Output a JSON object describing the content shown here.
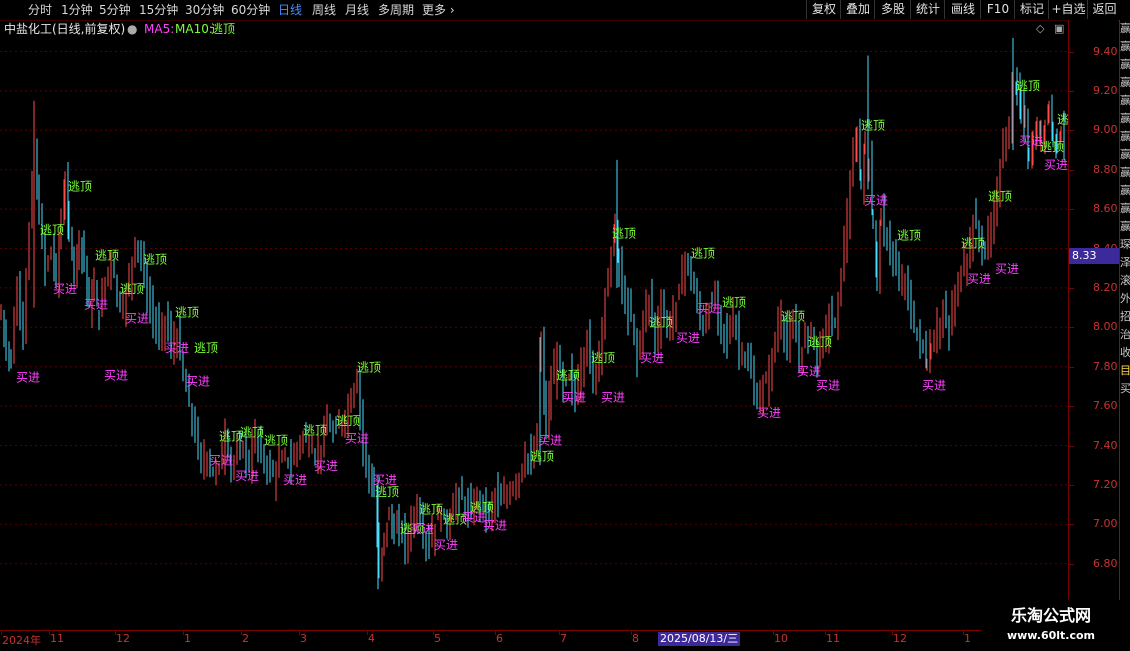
{
  "toolbar": {
    "periods": [
      "分时",
      "1分钟",
      "5分钟",
      "15分钟",
      "30分钟",
      "60分钟",
      "日线",
      "周线",
      "月线",
      "多周期",
      "更多"
    ],
    "active_period": "日线",
    "tools": [
      "复权",
      "叠加",
      "多股",
      "统计",
      "画线",
      "F10",
      "标记",
      "+自选",
      "返回"
    ]
  },
  "legend": {
    "stock": "中盐化工(日线,前复权)",
    "ma5": "MA5:",
    "ma10": "MA10:",
    "signal": "逃顶"
  },
  "price_axis": {
    "ticks": [
      "9.40",
      "9.20",
      "9.00",
      "8.80",
      "8.60",
      "8.40",
      "8.20",
      "8.00",
      "7.80",
      "7.60",
      "7.40",
      "7.20",
      "7.00",
      "6.80"
    ],
    "current_price": "8.33"
  },
  "time_axis": {
    "labels": [
      "2024年",
      "11",
      "12",
      "1",
      "2",
      "3",
      "4",
      "5",
      "6",
      "7",
      "8",
      "10",
      "11",
      "12",
      "1"
    ],
    "cursor_date": "2025/08/13/三"
  },
  "signals": {
    "buy": "买进",
    "sell": "逃顶"
  },
  "right_strip": [
    "赢",
    "赢",
    "赢",
    "赢",
    "赢",
    "赢",
    "赢",
    "赢",
    "赢",
    "赢",
    "赢",
    "赢",
    "琛",
    "泽",
    "滚",
    "外",
    "招",
    "治",
    "收",
    "目",
    "买"
  ],
  "watermark": {
    "line1": "乐淘公式网",
    "line2": "www.60lt.com"
  },
  "colors": {
    "up": "#ff4a4a",
    "down": "#4adcff",
    "buy": "#ff40ff",
    "sell": "#7cff3c",
    "grid": "#5a0000",
    "axis_text": "#c83232"
  },
  "chart_data": {
    "type": "candlestick",
    "title": "中盐化工(日线,前复权)",
    "ylim": [
      6.62,
      9.55
    ],
    "y_ticks": [
      6.8,
      7.0,
      7.2,
      7.4,
      7.6,
      7.8,
      8.0,
      8.2,
      8.4,
      8.6,
      8.8,
      9.0,
      9.2,
      9.4
    ],
    "current_price": 8.33,
    "approx_close_path": [
      [
        0,
        8.05
      ],
      [
        5,
        7.9
      ],
      [
        10,
        7.85
      ],
      [
        16,
        8.2
      ],
      [
        22,
        8.0
      ],
      [
        28,
        8.5
      ],
      [
        33,
        8.9
      ],
      [
        38,
        8.55
      ],
      [
        44,
        8.3
      ],
      [
        50,
        8.4
      ],
      [
        55,
        8.25
      ],
      [
        60,
        8.55
      ],
      [
        64,
        8.7
      ],
      [
        68,
        8.5
      ],
      [
        73,
        8.3
      ],
      [
        78,
        8.45
      ],
      [
        83,
        8.35
      ],
      [
        88,
        8.1
      ],
      [
        93,
        8.2
      ],
      [
        98,
        8.05
      ],
      [
        104,
        8.25
      ],
      [
        110,
        8.35
      ],
      [
        116,
        8.15
      ],
      [
        122,
        8.1
      ],
      [
        128,
        8.25
      ],
      [
        134,
        8.45
      ],
      [
        140,
        8.35
      ],
      [
        146,
        8.15
      ],
      [
        152,
        8.05
      ],
      [
        158,
        7.95
      ],
      [
        164,
        8.05
      ],
      [
        170,
        7.9
      ],
      [
        176,
        7.95
      ],
      [
        182,
        7.75
      ],
      [
        188,
        7.6
      ],
      [
        194,
        7.45
      ],
      [
        200,
        7.3
      ],
      [
        206,
        7.35
      ],
      [
        212,
        7.25
      ],
      [
        218,
        7.3
      ],
      [
        224,
        7.45
      ],
      [
        230,
        7.3
      ],
      [
        236,
        7.35
      ],
      [
        242,
        7.4
      ],
      [
        248,
        7.3
      ],
      [
        254,
        7.45
      ],
      [
        260,
        7.35
      ],
      [
        266,
        7.3
      ],
      [
        272,
        7.25
      ],
      [
        278,
        7.3
      ],
      [
        284,
        7.35
      ],
      [
        290,
        7.3
      ],
      [
        296,
        7.4
      ],
      [
        302,
        7.45
      ],
      [
        308,
        7.4
      ],
      [
        314,
        7.35
      ],
      [
        320,
        7.4
      ],
      [
        326,
        7.5
      ],
      [
        332,
        7.45
      ],
      [
        338,
        7.5
      ],
      [
        344,
        7.55
      ],
      [
        350,
        7.65
      ],
      [
        356,
        7.75
      ],
      [
        362,
        7.4
      ],
      [
        368,
        7.25
      ],
      [
        373,
        7.15
      ],
      [
        378,
        6.75
      ],
      [
        383,
        6.95
      ],
      [
        388,
        7.05
      ],
      [
        393,
        6.95
      ],
      [
        398,
        7.0
      ],
      [
        404,
        6.9
      ],
      [
        410,
        7.0
      ],
      [
        416,
        7.1
      ],
      [
        422,
        6.95
      ],
      [
        428,
        6.9
      ],
      [
        434,
        7.0
      ],
      [
        440,
        7.05
      ],
      [
        446,
        7.0
      ],
      [
        452,
        7.1
      ],
      [
        458,
        7.15
      ],
      [
        464,
        7.1
      ],
      [
        470,
        7.05
      ],
      [
        476,
        7.15
      ],
      [
        482,
        7.1
      ],
      [
        488,
        7.05
      ],
      [
        494,
        7.15
      ],
      [
        500,
        7.1
      ],
      [
        506,
        7.15
      ],
      [
        512,
        7.2
      ],
      [
        518,
        7.25
      ],
      [
        524,
        7.35
      ],
      [
        530,
        7.3
      ],
      [
        536,
        7.45
      ],
      [
        540,
        7.9
      ],
      [
        545,
        7.5
      ],
      [
        550,
        7.7
      ],
      [
        556,
        7.85
      ],
      [
        562,
        7.7
      ],
      [
        568,
        7.75
      ],
      [
        574,
        7.65
      ],
      [
        580,
        7.8
      ],
      [
        586,
        7.95
      ],
      [
        592,
        7.7
      ],
      [
        598,
        7.9
      ],
      [
        604,
        8.15
      ],
      [
        610,
        8.4
      ],
      [
        614,
        8.5
      ],
      [
        618,
        8.3
      ],
      [
        624,
        8.1
      ],
      [
        630,
        8.05
      ],
      [
        636,
        7.85
      ],
      [
        642,
        8.05
      ],
      [
        648,
        8.15
      ],
      [
        654,
        7.95
      ],
      [
        660,
        8.1
      ],
      [
        666,
        8.0
      ],
      [
        672,
        8.05
      ],
      [
        678,
        8.2
      ],
      [
        684,
        8.35
      ],
      [
        690,
        8.25
      ],
      [
        696,
        8.1
      ],
      [
        702,
        8.0
      ],
      [
        708,
        8.1
      ],
      [
        714,
        8.15
      ],
      [
        720,
        8.0
      ],
      [
        726,
        7.95
      ],
      [
        732,
        8.05
      ],
      [
        738,
        7.9
      ],
      [
        744,
        7.85
      ],
      [
        750,
        7.75
      ],
      [
        756,
        7.6
      ],
      [
        762,
        7.7
      ],
      [
        768,
        7.75
      ],
      [
        774,
        7.95
      ],
      [
        780,
        8.05
      ],
      [
        786,
        7.9
      ],
      [
        792,
        8.0
      ],
      [
        798,
        7.85
      ],
      [
        804,
        7.95
      ],
      [
        810,
        8.0
      ],
      [
        816,
        7.85
      ],
      [
        822,
        7.95
      ],
      [
        828,
        8.05
      ],
      [
        834,
        8.0
      ],
      [
        840,
        8.3
      ],
      [
        846,
        8.55
      ],
      [
        852,
        8.85
      ],
      [
        856,
        8.95
      ],
      [
        860,
        8.75
      ],
      [
        864,
        8.9
      ],
      [
        868,
        8.85
      ],
      [
        872,
        8.5
      ],
      [
        876,
        8.3
      ],
      [
        880,
        8.55
      ],
      [
        886,
        8.45
      ],
      [
        892,
        8.35
      ],
      [
        898,
        8.2
      ],
      [
        904,
        8.25
      ],
      [
        910,
        8.05
      ],
      [
        916,
        7.95
      ],
      [
        922,
        7.9
      ],
      [
        926,
        7.8
      ],
      [
        930,
        7.9
      ],
      [
        936,
        8.0
      ],
      [
        942,
        8.05
      ],
      [
        948,
        8.0
      ],
      [
        954,
        8.15
      ],
      [
        960,
        8.3
      ],
      [
        966,
        8.35
      ],
      [
        972,
        8.55
      ],
      [
        978,
        8.45
      ],
      [
        984,
        8.4
      ],
      [
        990,
        8.5
      ],
      [
        996,
        8.7
      ],
      [
        1002,
        8.9
      ],
      [
        1008,
        9.05
      ],
      [
        1012,
        9.25
      ],
      [
        1016,
        9.2
      ],
      [
        1020,
        9.1
      ],
      [
        1024,
        9.05
      ],
      [
        1028,
        8.85
      ],
      [
        1032,
        8.9
      ],
      [
        1036,
        9.0
      ],
      [
        1040,
        8.95
      ],
      [
        1044,
        9.05
      ],
      [
        1048,
        9.1
      ],
      [
        1052,
        9.0
      ],
      [
        1056,
        8.95
      ],
      [
        1060,
        9.0
      ],
      [
        1064,
        8.95
      ]
    ],
    "signal_points": [
      {
        "t": "sell",
        "x": 68,
        "y": 8.72
      },
      {
        "t": "sell",
        "x": 40,
        "y": 8.5
      },
      {
        "t": "buy",
        "x": 53,
        "y": 8.2
      },
      {
        "t": "buy",
        "x": 84,
        "y": 8.12
      },
      {
        "t": "sell",
        "x": 95,
        "y": 8.37
      },
      {
        "t": "sell",
        "x": 120,
        "y": 8.2
      },
      {
        "t": "sell",
        "x": 143,
        "y": 8.35
      },
      {
        "t": "buy",
        "x": 125,
        "y": 8.05
      },
      {
        "t": "sell",
        "x": 175,
        "y": 8.08
      },
      {
        "t": "buy",
        "x": 165,
        "y": 7.9
      },
      {
        "t": "sell",
        "x": 194,
        "y": 7.9
      },
      {
        "t": "buy",
        "x": 186,
        "y": 7.73
      },
      {
        "t": "buy",
        "x": 16,
        "y": 7.75
      },
      {
        "t": "buy",
        "x": 104,
        "y": 7.76
      },
      {
        "t": "sell",
        "x": 219,
        "y": 7.45
      },
      {
        "t": "sell",
        "x": 240,
        "y": 7.47
      },
      {
        "t": "sell",
        "x": 264,
        "y": 7.43
      },
      {
        "t": "sell",
        "x": 303,
        "y": 7.48
      },
      {
        "t": "sell",
        "x": 336,
        "y": 7.53
      },
      {
        "t": "buy",
        "x": 209,
        "y": 7.33
      },
      {
        "t": "buy",
        "x": 235,
        "y": 7.25
      },
      {
        "t": "buy",
        "x": 283,
        "y": 7.23
      },
      {
        "t": "buy",
        "x": 314,
        "y": 7.3
      },
      {
        "t": "buy",
        "x": 345,
        "y": 7.44
      },
      {
        "t": "sell",
        "x": 357,
        "y": 7.8
      },
      {
        "t": "buy",
        "x": 373,
        "y": 7.23
      },
      {
        "t": "sell",
        "x": 375,
        "y": 7.17
      },
      {
        "t": "sell",
        "x": 419,
        "y": 7.08
      },
      {
        "t": "sell",
        "x": 400,
        "y": 6.98
      },
      {
        "t": "buy",
        "x": 410,
        "y": 6.98
      },
      {
        "t": "buy",
        "x": 434,
        "y": 6.9
      },
      {
        "t": "sell",
        "x": 443,
        "y": 7.03
      },
      {
        "t": "sell",
        "x": 470,
        "y": 7.09
      },
      {
        "t": "buy",
        "x": 462,
        "y": 7.04
      },
      {
        "t": "buy",
        "x": 483,
        "y": 7.0
      },
      {
        "t": "sell",
        "x": 530,
        "y": 7.35
      },
      {
        "t": "buy",
        "x": 538,
        "y": 7.43
      },
      {
        "t": "sell",
        "x": 556,
        "y": 7.76
      },
      {
        "t": "buy",
        "x": 562,
        "y": 7.65
      },
      {
        "t": "sell",
        "x": 591,
        "y": 7.85
      },
      {
        "t": "buy",
        "x": 601,
        "y": 7.65
      },
      {
        "t": "sell",
        "x": 612,
        "y": 8.48
      },
      {
        "t": "sell",
        "x": 649,
        "y": 8.03
      },
      {
        "t": "buy",
        "x": 640,
        "y": 7.85
      },
      {
        "t": "buy",
        "x": 676,
        "y": 7.95
      },
      {
        "t": "sell",
        "x": 691,
        "y": 8.38
      },
      {
        "t": "buy",
        "x": 697,
        "y": 8.1
      },
      {
        "t": "sell",
        "x": 722,
        "y": 8.13
      },
      {
        "t": "sell",
        "x": 781,
        "y": 8.06
      },
      {
        "t": "sell",
        "x": 808,
        "y": 7.93
      },
      {
        "t": "buy",
        "x": 797,
        "y": 7.78
      },
      {
        "t": "buy",
        "x": 816,
        "y": 7.71
      },
      {
        "t": "buy",
        "x": 757,
        "y": 7.57
      },
      {
        "t": "sell",
        "x": 861,
        "y": 9.03
      },
      {
        "t": "buy",
        "x": 864,
        "y": 8.65
      },
      {
        "t": "sell",
        "x": 897,
        "y": 8.47
      },
      {
        "t": "buy",
        "x": 922,
        "y": 7.71
      },
      {
        "t": "sell",
        "x": 961,
        "y": 8.43
      },
      {
        "t": "buy",
        "x": 967,
        "y": 8.25
      },
      {
        "t": "buy",
        "x": 995,
        "y": 8.3
      },
      {
        "t": "sell",
        "x": 988,
        "y": 8.67
      },
      {
        "t": "sell",
        "x": 1016,
        "y": 9.23
      },
      {
        "t": "buy",
        "x": 1019,
        "y": 8.95
      },
      {
        "t": "sell",
        "x": 1040,
        "y": 8.92
      },
      {
        "t": "buy",
        "x": 1044,
        "y": 8.83
      },
      {
        "t": "sell",
        "x": 1057,
        "y": 9.06
      }
    ]
  }
}
